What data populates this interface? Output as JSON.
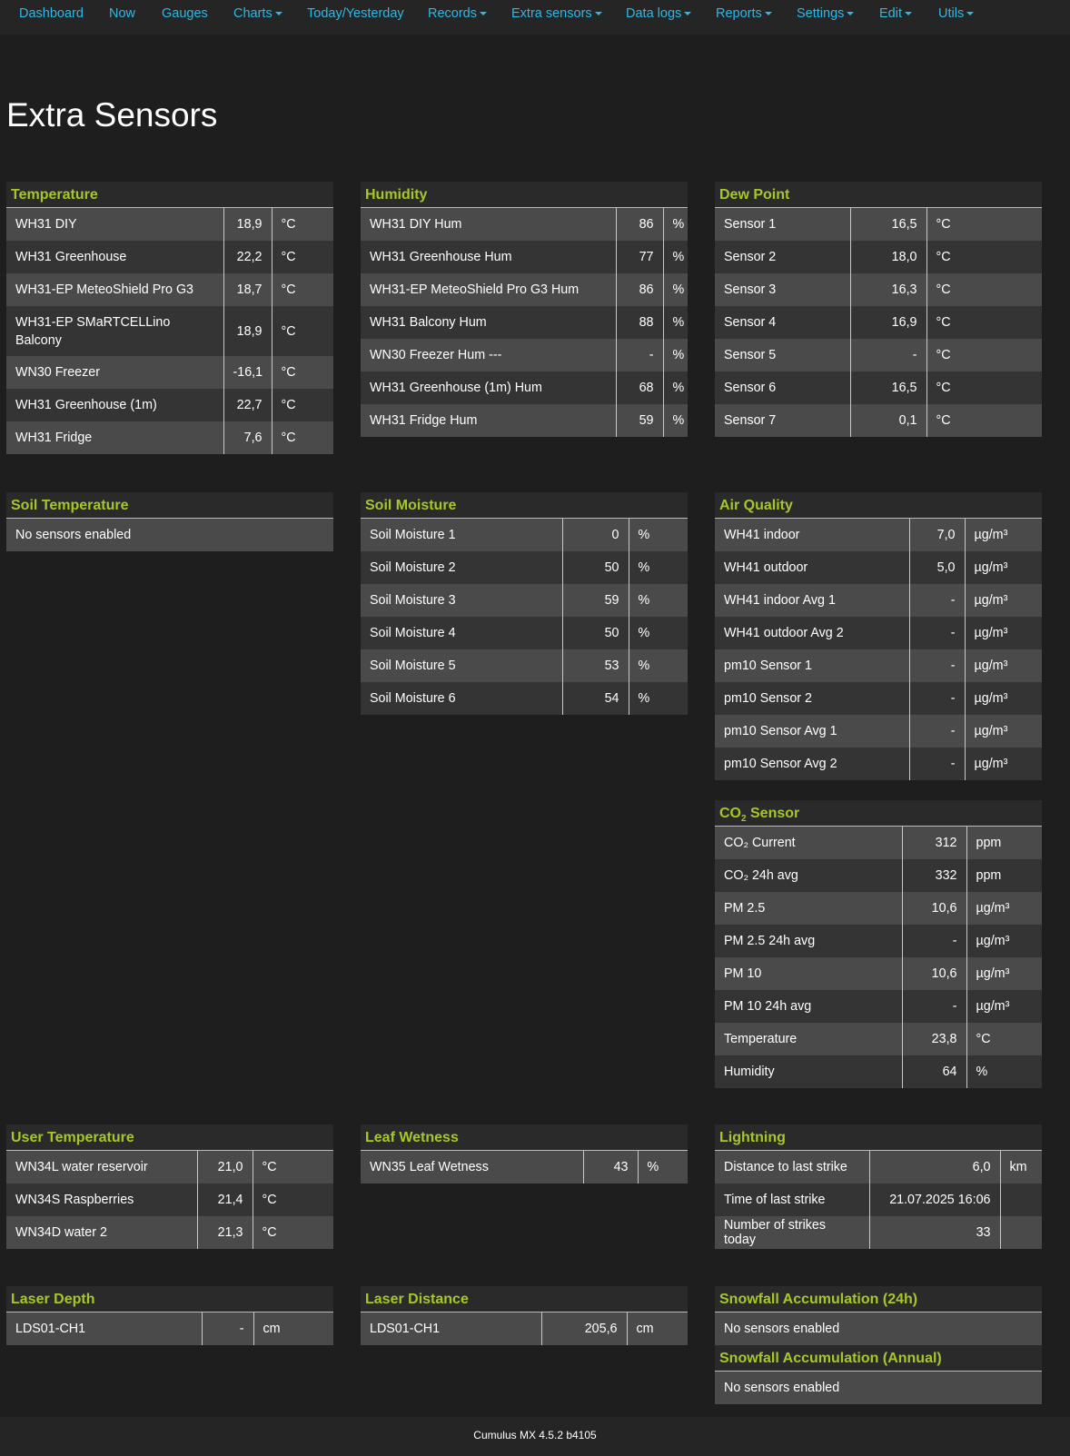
{
  "nav": [
    {
      "label": "Dashboard",
      "caret": false
    },
    {
      "label": "Now",
      "caret": false
    },
    {
      "label": "Gauges",
      "caret": false
    },
    {
      "label": "Charts",
      "caret": true
    },
    {
      "label": "Today/Yesterday",
      "caret": false
    },
    {
      "label": "Records",
      "caret": true
    },
    {
      "label": "Extra sensors",
      "caret": true
    },
    {
      "label": "Data logs",
      "caret": true
    },
    {
      "label": "Reports",
      "caret": true
    },
    {
      "label": "Settings",
      "caret": true
    },
    {
      "label": "Edit",
      "caret": true
    },
    {
      "label": "Utils",
      "caret": true
    }
  ],
  "page_title": "Extra Sensors",
  "panels": {
    "temperature": {
      "title": "Temperature",
      "rows": [
        {
          "name": "WH31 DIY",
          "value": "18,9",
          "unit": "°C"
        },
        {
          "name": "WH31 Greenhouse",
          "value": "22,2",
          "unit": "°C"
        },
        {
          "name": "WH31-EP MeteoShield Pro G3",
          "value": "18,7",
          "unit": "°C"
        },
        {
          "name": "WH31-EP SMaRTCELLino Balcony",
          "value": "18,9",
          "unit": "°C"
        },
        {
          "name": "WN30 Freezer",
          "value": "-16,1",
          "unit": "°C"
        },
        {
          "name": "WH31 Greenhouse (1m)",
          "value": "22,7",
          "unit": "°C"
        },
        {
          "name": "WH31 Fridge",
          "value": "7,6",
          "unit": "°C"
        }
      ]
    },
    "humidity": {
      "title": "Humidity",
      "rows": [
        {
          "name": "WH31 DIY Hum",
          "value": "86",
          "unit": "%"
        },
        {
          "name": "WH31 Greenhouse Hum",
          "value": "77",
          "unit": "%"
        },
        {
          "name": "WH31-EP MeteoShield Pro G3 Hum",
          "value": "86",
          "unit": "%"
        },
        {
          "name": "WH31 Balcony Hum",
          "value": "88",
          "unit": "%"
        },
        {
          "name": "WN30 Freezer Hum ---",
          "value": "-",
          "unit": "%"
        },
        {
          "name": "WH31 Greenhouse (1m) Hum",
          "value": "68",
          "unit": "%"
        },
        {
          "name": "WH31 Fridge Hum",
          "value": "59",
          "unit": "%"
        }
      ]
    },
    "dew_point": {
      "title": "Dew Point",
      "rows": [
        {
          "name": "Sensor 1",
          "value": "16,5",
          "unit": "°C"
        },
        {
          "name": "Sensor 2",
          "value": "18,0",
          "unit": "°C"
        },
        {
          "name": "Sensor 3",
          "value": "16,3",
          "unit": "°C"
        },
        {
          "name": "Sensor 4",
          "value": "16,9",
          "unit": "°C"
        },
        {
          "name": "Sensor 5",
          "value": "-",
          "unit": "°C"
        },
        {
          "name": "Sensor 6",
          "value": "16,5",
          "unit": "°C"
        },
        {
          "name": "Sensor 7",
          "value": "0,1",
          "unit": "°C"
        }
      ]
    },
    "soil_temperature": {
      "title": "Soil Temperature",
      "empty": "No sensors enabled"
    },
    "soil_moisture": {
      "title": "Soil Moisture",
      "rows": [
        {
          "name": "Soil Moisture 1",
          "value": "0",
          "unit": "%"
        },
        {
          "name": "Soil Moisture 2",
          "value": "50",
          "unit": "%"
        },
        {
          "name": "Soil Moisture 3",
          "value": "59",
          "unit": "%"
        },
        {
          "name": "Soil Moisture 4",
          "value": "50",
          "unit": "%"
        },
        {
          "name": "Soil Moisture 5",
          "value": "53",
          "unit": "%"
        },
        {
          "name": "Soil Moisture 6",
          "value": "54",
          "unit": "%"
        }
      ]
    },
    "air_quality": {
      "title": "Air Quality",
      "rows": [
        {
          "name": "WH41 indoor",
          "value": "7,0",
          "unit": "µg/m³"
        },
        {
          "name": "WH41 outdoor",
          "value": "5,0",
          "unit": "µg/m³"
        },
        {
          "name": "WH41 indoor Avg 1",
          "value": "-",
          "unit": "µg/m³"
        },
        {
          "name": "WH41 outdoor Avg 2",
          "value": "-",
          "unit": "µg/m³"
        },
        {
          "name": "pm10 Sensor 1",
          "value": "-",
          "unit": "µg/m³"
        },
        {
          "name": "pm10 Sensor 2",
          "value": "-",
          "unit": "µg/m³"
        },
        {
          "name": "pm10 Sensor Avg 1",
          "value": "-",
          "unit": "µg/m³"
        },
        {
          "name": "pm10 Sensor Avg 2",
          "value": "-",
          "unit": "µg/m³"
        }
      ]
    },
    "co2": {
      "title_prefix": "CO",
      "title_sub": "2",
      "title_suffix": " Sensor",
      "rows": [
        {
          "name": "CO₂ Current",
          "value": "312",
          "unit": "ppm"
        },
        {
          "name": "CO₂ 24h avg",
          "value": "332",
          "unit": "ppm"
        },
        {
          "name": "PM 2.5",
          "value": "10,6",
          "unit": "µg/m³"
        },
        {
          "name": "PM 2.5 24h avg",
          "value": "-",
          "unit": "µg/m³"
        },
        {
          "name": "PM 10",
          "value": "10,6",
          "unit": "µg/m³"
        },
        {
          "name": "PM 10 24h avg",
          "value": "-",
          "unit": "µg/m³"
        },
        {
          "name": "Temperature",
          "value": "23,8",
          "unit": "°C"
        },
        {
          "name": "Humidity",
          "value": "64",
          "unit": "%"
        }
      ]
    },
    "user_temperature": {
      "title": "User Temperature",
      "rows": [
        {
          "name": "WN34L water reservoir",
          "value": "21,0",
          "unit": "°C"
        },
        {
          "name": "WN34S Raspberries",
          "value": "21,4",
          "unit": "°C"
        },
        {
          "name": "WN34D water 2",
          "value": "21,3",
          "unit": "°C"
        }
      ]
    },
    "leaf_wetness": {
      "title": "Leaf Wetness",
      "rows": [
        {
          "name": "WN35 Leaf Wetness",
          "value": "43",
          "unit": "%"
        }
      ]
    },
    "lightning": {
      "title": "Lightning",
      "rows": [
        {
          "name": "Distance to last strike",
          "value": "6,0",
          "unit": "km"
        },
        {
          "name": "Time of last strike",
          "value": "21.07.2025 16:06",
          "unit": ""
        },
        {
          "name": "Number of strikes today",
          "value": "33",
          "unit": ""
        }
      ]
    },
    "laser_depth": {
      "title": "Laser Depth",
      "rows": [
        {
          "name": "LDS01-CH1",
          "value": "-",
          "unit": "cm"
        }
      ]
    },
    "laser_distance": {
      "title": "Laser Distance",
      "rows": [
        {
          "name": "LDS01-CH1",
          "value": "205,6",
          "unit": "cm"
        }
      ]
    },
    "snow_24h": {
      "title": "Snowfall Accumulation (24h)",
      "empty": "No sensors enabled"
    },
    "snow_annual": {
      "title": "Snowfall Accumulation (Annual)",
      "empty": "No sensors enabled"
    }
  },
  "footer": "Cumulus MX 4.5.2 b4105",
  "colors": {
    "background": "#1e1e1e",
    "nav_link": "#2eb8e6",
    "panel_title": "#a6c72a",
    "row_odd": "#4a4a4a",
    "row_even": "#343434"
  }
}
